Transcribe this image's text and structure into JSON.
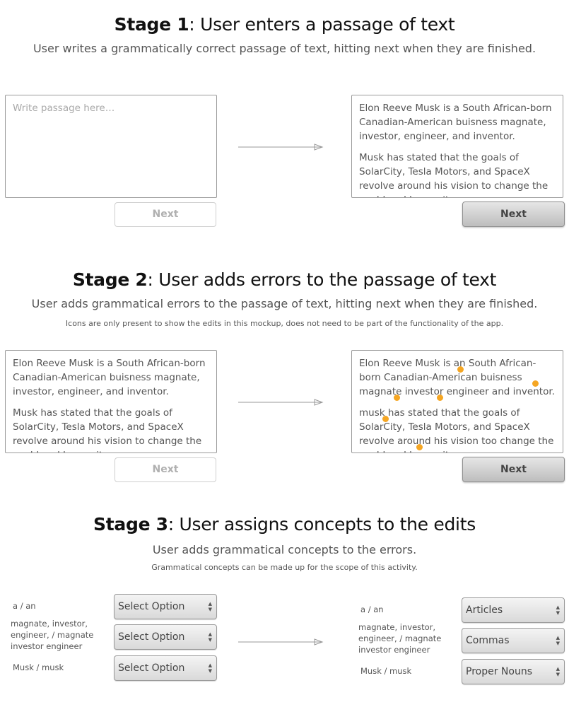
{
  "stage1": {
    "title_bold": "Stage 1",
    "title_rest": ": User enters a passage of text",
    "subtitle": "User writes a grammatically correct passage of text, hitting next when they are finished.",
    "input_placeholder": "Write passage here…",
    "next_label_disabled": "Next",
    "passage_para1": "Elon Reeve Musk is a South African-born Canadian-American buisness magnate, investor, engineer, and inventor.",
    "passage_para2": "Musk has stated that the goals of SolarCity, Tesla Motors, and SpaceX revolve around his vision to change the world and humanity.",
    "next_label_active": "Next"
  },
  "stage2": {
    "title_bold": "Stage 2",
    "title_rest": ": User adds errors to the passage of text",
    "subtitle": "User adds grammatical errors to the passage of text, hitting next when they are finished.",
    "note": "Icons are only present to show the edits in this mockup, does not need to be part of the functionality of the app.",
    "original_para1": "Elon Reeve Musk is a South African-born Canadian-American buisness magnate, investor, engineer, and inventor.",
    "original_para2": "Musk has stated that the goals of SolarCity, Tesla Motors, and SpaceX revolve around his vision to change the world and humanity.",
    "edited_para1": "Elon Reeve Musk is an South African-born Canadian-American buisness magnate investor engineer and inventor.",
    "edited_para2": "musk has stated that the goals of SolarCity, Tesla Motors, and SpaceX revolve around his vision too change the world and humanity.",
    "next_label_disabled": "Next",
    "next_label_active": "Next"
  },
  "stage3": {
    "title_bold": "Stage 3",
    "title_rest": ": User assigns concepts to the edits",
    "subtitle": "User adds grammatical concepts to the errors.",
    "note": "Grammatical concepts can be made up for the scope of this activity.",
    "left": [
      {
        "label": "a / an",
        "select": "Select Option"
      },
      {
        "label": "magnate, investor, engineer, / magnate investor engineer",
        "select": "Select Option"
      },
      {
        "label": "Musk / musk",
        "select": "Select Option"
      }
    ],
    "right": [
      {
        "label": "a / an",
        "select": "Articles"
      },
      {
        "label": "magnate, investor, engineer, / magnate investor engineer",
        "select": "Commas"
      },
      {
        "label": "Musk / musk",
        "select": "Proper Nouns"
      }
    ]
  },
  "colors": {
    "edit_marker": "#f5a623",
    "arrow": "#999999"
  },
  "icons": {
    "arrow": "right-arrow-icon",
    "edit_marker": "edit-marker-icon",
    "select_caret": "up-down-caret-icon"
  }
}
